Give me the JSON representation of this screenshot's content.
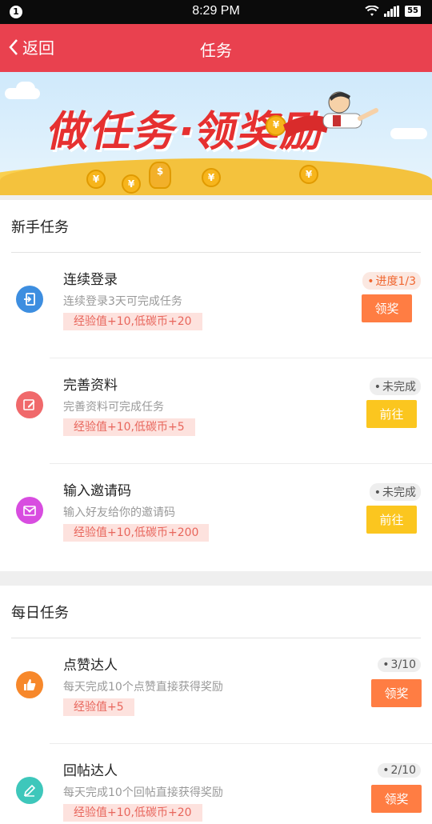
{
  "status_bar": {
    "time": "8:29 PM",
    "notification_count": "1",
    "battery": "55"
  },
  "app_bar": {
    "back_label": "返回",
    "title": "任务"
  },
  "banner": {
    "text": "做任务·领奖励"
  },
  "sections": [
    {
      "title": "新手任务",
      "tasks": [
        {
          "name": "连续登录",
          "desc": "连续登录3天可完成任务",
          "reward": "经验值+10,低碳币+20",
          "status": "进度1/3",
          "button": "领奖",
          "icon": "login-icon",
          "icon_color": "#3d8ee0"
        },
        {
          "name": "完善资料",
          "desc": "完善资料可完成任务",
          "reward": "经验值+10,低碳币+5",
          "status": "未完成",
          "button": "前往",
          "icon": "edit-icon",
          "icon_color": "#f0696b"
        },
        {
          "name": "输入邀请码",
          "desc": "输入好友给你的邀请码",
          "reward": "经验值+10,低碳币+200",
          "status": "未完成",
          "button": "前往",
          "icon": "invite-mail-icon",
          "icon_color": "#d84de0"
        }
      ]
    },
    {
      "title": "每日任务",
      "tasks": [
        {
          "name": "点赞达人",
          "desc": "每天完成10个点赞直接获得奖励",
          "reward": "经验值+5",
          "status": "3/10",
          "button": "领奖",
          "icon": "thumbs-up-icon",
          "icon_color": "#f7882b"
        },
        {
          "name": "回帖达人",
          "desc": "每天完成10个回帖直接获得奖励",
          "reward": "经验值+10,低碳币+20",
          "status": "2/10",
          "button": "领奖",
          "icon": "pencil-icon",
          "icon_color": "#3ec7bb"
        }
      ]
    }
  ],
  "colors": {
    "header": "#e9414f",
    "btn_claim": "#ff7d43",
    "btn_go": "#fbc61f",
    "reward_bg": "#fde2de"
  }
}
